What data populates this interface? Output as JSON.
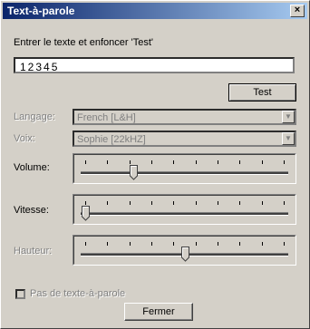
{
  "window": {
    "title": "Text-à-parole",
    "close_glyph": "×"
  },
  "instruction": "Entrer le texte et enfoncer 'Test'",
  "text_input": {
    "value": "12345"
  },
  "test_button": "Test",
  "language": {
    "label": "Langage:",
    "value": "French [L&H]"
  },
  "voice": {
    "label": "Voix:",
    "value": "Sophie [22kHZ]"
  },
  "volume": {
    "label": "Volume:",
    "level_fraction": 0.24
  },
  "speed": {
    "label": "Vitesse:",
    "level_fraction": 0.0
  },
  "pitch": {
    "label": "Hauteur:",
    "level_fraction": 0.5
  },
  "no_tts": {
    "label": "Pas de texte-à-parole"
  },
  "close_button": "Fermer",
  "slider_ticks": 10
}
